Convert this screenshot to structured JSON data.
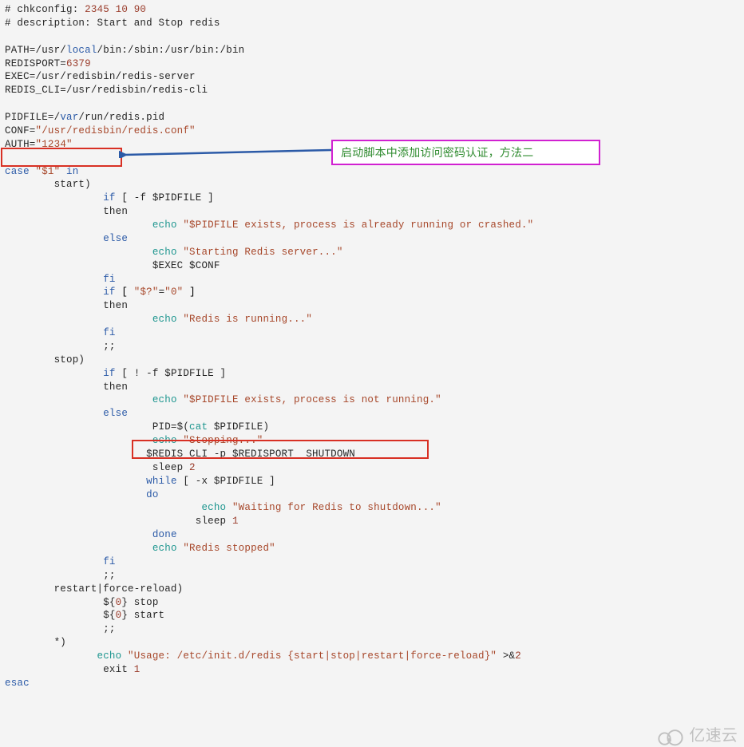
{
  "callout_text": "启动脚本中添加访问密码认证，方法二",
  "watermark_text": "亿速云",
  "code": {
    "l01": "# chkconfig: 2345 10 90",
    "l02": "# description: Start and Stop redis",
    "l03": "",
    "l04_a": "PATH=/usr/",
    "l04_b": "local",
    "l04_c": "/bin:/sbin:/usr/bin:/bin",
    "l05_a": "REDISPORT=",
    "l05_b": "6379",
    "l06_a": "EXEC=/usr/redisbin/redis-server",
    "l07_a": "REDIS_CLI=/usr/redisbin/redis-cli",
    "l08": "",
    "l09_a": "PIDFILE=/",
    "l09_b": "var",
    "l09_c": "/run/redis.pid",
    "l10_a": "CONF=",
    "l10_b": "\"/usr/redisbin/redis.conf\"",
    "l11_a": "AUTH=",
    "l11_b": "\"1234\"",
    "l12": "",
    "l13_a": "case",
    "l13_b": " \"$1\" ",
    "l13_c": "in",
    "l14": "        start)",
    "l15_a": "                ",
    "l15_b": "if",
    "l15_c": " [ -f $PIDFILE ]",
    "l16": "                then",
    "l17_a": "                        ",
    "l17_b": "echo",
    "l17_c": " \"$PIDFILE exists, process is already running or crashed.\"",
    "l18_a": "                ",
    "l18_b": "else",
    "l19_a": "                        ",
    "l19_b": "echo",
    "l19_c": " \"Starting Redis server...\"",
    "l20": "                        $EXEC $CONF",
    "l21_a": "                ",
    "l21_b": "fi",
    "l22_a": "                ",
    "l22_b": "if",
    "l22_c": " [ ",
    "l22_d": "\"$?\"",
    "l22_e": "=",
    "l22_f": "\"0\"",
    "l22_g": " ]",
    "l23": "                then",
    "l24_a": "                        ",
    "l24_b": "echo",
    "l24_c": " \"Redis is running...\"",
    "l25_a": "                ",
    "l25_b": "fi",
    "l26": "                ;;",
    "l27": "        stop)",
    "l28_a": "                ",
    "l28_b": "if",
    "l28_c": " [ ! -f $PIDFILE ]",
    "l29": "                then",
    "l30_a": "                        ",
    "l30_b": "echo",
    "l30_c": " \"$PIDFILE exists, process is not running.\"",
    "l31_a": "                ",
    "l31_b": "else",
    "l32_a": "                        PID=$(",
    "l32_b": "cat",
    "l32_c": " $PIDFILE)",
    "l33_a": "                        ",
    "l33_b": "echo",
    "l33_c": " \"Stopping...\"",
    "l34": "                       $REDIS_CLI -p $REDISPORT  SHUTDOWN",
    "l35_a": "                        sleep ",
    "l35_b": "2",
    "l36_a": "                       ",
    "l36_b": "while",
    "l36_c": " [ -x $PIDFILE ]",
    "l37_a": "                       ",
    "l37_b": "do",
    "l38_a": "                                ",
    "l38_b": "echo",
    "l38_c": " \"Waiting for Redis to shutdown...\"",
    "l39_a": "                               sleep ",
    "l39_b": "1",
    "l40_a": "                        ",
    "l40_b": "done",
    "l41_a": "                        ",
    "l41_b": "echo",
    "l41_c": " \"Redis stopped\"",
    "l42_a": "                ",
    "l42_b": "fi",
    "l43": "                ;;",
    "l44": "        restart|force-reload)",
    "l45_a": "                ${",
    "l45_b": "0",
    "l45_c": "} stop",
    "l46_a": "                ${",
    "l46_b": "0",
    "l46_c": "} start",
    "l47": "                ;;",
    "l48": "        *)",
    "l49_a": "               ",
    "l49_b": "echo",
    "l49_c": " \"Usage: /etc/init.d/redis {start|stop|restart|force-reload}\"",
    "l49_d": " >&",
    "l49_e": "2",
    "l50_a": "                exit ",
    "l50_b": "1",
    "l51": "esac"
  }
}
